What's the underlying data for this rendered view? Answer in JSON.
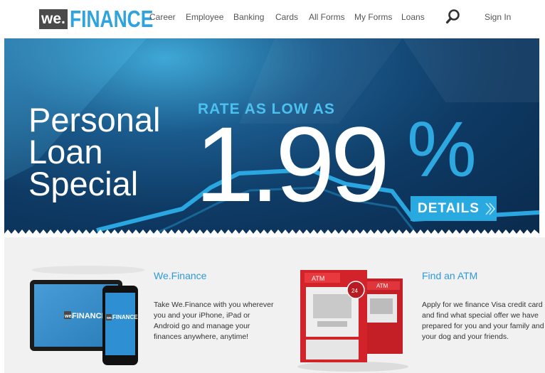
{
  "header": {
    "logo_we": "we.",
    "logo_finance": "FINANCE",
    "nav": [
      {
        "label": "Career"
      },
      {
        "label": "Employee"
      },
      {
        "label": "Banking"
      },
      {
        "label": "Cards"
      },
      {
        "label": "All Forms"
      },
      {
        "label": "My Forms"
      },
      {
        "label": "Loans"
      }
    ],
    "search_icon": "search-icon",
    "signin": "Sign In"
  },
  "hero": {
    "title_line1": "Personal",
    "title_line2": "Loan",
    "title_line3": "Special",
    "rate_label": "RATE AS LOW AS",
    "rate_value": "1.99",
    "rate_percent": "%",
    "details_label": "DETAILS",
    "details_icon": "chevron-right-icon"
  },
  "features": [
    {
      "title": "We.Finance",
      "text": "Take We.Finance with you wherever you and your iPhone, iPad or Android go and manage your finances anywhere, anytime!",
      "device_logo": "FINANCE",
      "device_logo_we": "we."
    },
    {
      "title": "Find an ATM",
      "text": "Apply for we finance Visa credit card and find what special offer we have prepared for you and your family and your dog and your friends.",
      "atm_label": "ATM",
      "atm_badge": "24"
    }
  ],
  "colors": {
    "brand_blue": "#2ea3dc",
    "hero_dark": "#0e3a64",
    "atm_red": "#d2232a"
  }
}
